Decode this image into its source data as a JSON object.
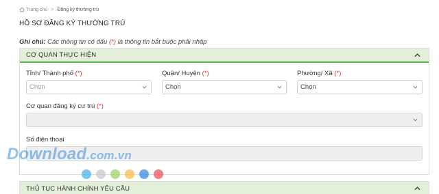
{
  "breadcrumb": {
    "home_label": "Trang chủ",
    "separator": ">",
    "current": "Đăng ký thường trú"
  },
  "page_title": "HỒ SƠ ĐĂNG KÝ THƯỜNG TRÚ",
  "note": {
    "prefix": "Ghi chú:",
    "text_before": " Các thông tin có dấu ",
    "marker": "(*)",
    "text_after": " là thông tin bắt buộc phải nhập"
  },
  "panels": [
    {
      "title": "CƠ QUAN THỰC HIỆN",
      "fields": {
        "province": {
          "label": "Tỉnh/ Thành phố",
          "required": "(*)",
          "value": "Chọn"
        },
        "district": {
          "label": "Quận/ Huyện",
          "required": "(*)",
          "value": "Chọn"
        },
        "ward": {
          "label": "Phường/ Xã",
          "required": "(*)",
          "value": "Chọn"
        },
        "agency": {
          "label": "Cơ quan đăng ký cư trú",
          "required": "(*)",
          "value": ""
        },
        "phone": {
          "label": "Số điện thoại",
          "value": ""
        }
      }
    },
    {
      "title": "THỦ TỤC HÀNH CHÍNH YÊU CẦU"
    }
  ],
  "watermark": {
    "brand": "Download",
    "domain": ".com.vn",
    "dot_colors": [
      "#4fb3ea",
      "#c9c9c9",
      "#9ed36a",
      "#f5c04b",
      "#3a8dde",
      "#e9545b"
    ]
  },
  "colors": {
    "panel_header_bg": "#e3efd9",
    "accent_green": "#4caf50",
    "required_red": "#d9342b"
  }
}
